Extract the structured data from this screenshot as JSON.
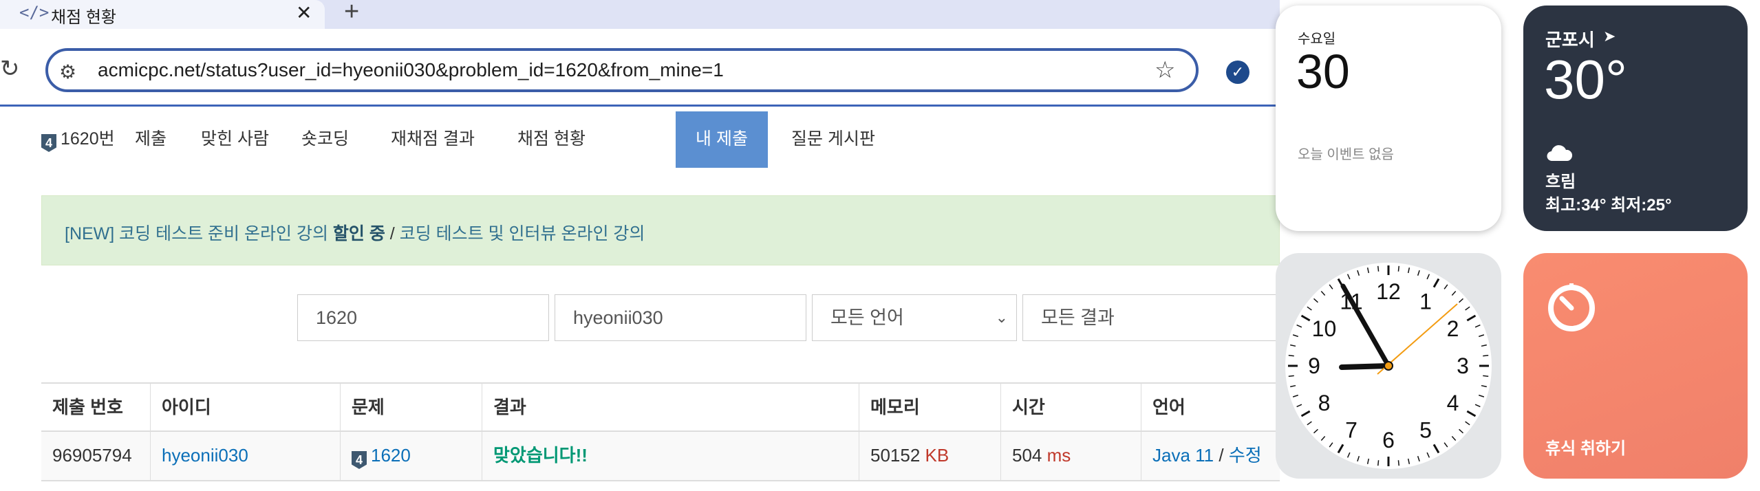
{
  "browser": {
    "tab_title": "채점 현황",
    "tab_icon": "</>",
    "close_glyph": "✕",
    "new_tab_glyph": "+",
    "url": "acmicpc.net/status?user_id=hyeonii030&problem_id=1620&from_mine=1"
  },
  "nav": {
    "tier": "4",
    "items": [
      "1620번",
      "제출",
      "맞힌 사람",
      "숏코딩",
      "재채점 결과",
      "채점 현황",
      "내 제출",
      "질문 게시판"
    ],
    "active": "내 제출"
  },
  "banner": {
    "prefix": "[NEW] 코딩 테스트 준비 온라인 강의 ",
    "highlight": "할인 중",
    "separator": " / ",
    "link2": "코딩 테스트 및 인터뷰 온라인 강의"
  },
  "filters": {
    "problem": "1620",
    "user": "hyeonii030",
    "language": "모든 언어",
    "result": "모든 결과"
  },
  "table": {
    "headers": [
      "제출 번호",
      "아이디",
      "문제",
      "결과",
      "메모리",
      "시간",
      "언어"
    ],
    "row": {
      "id": "96905794",
      "user": "hyeonii030",
      "problem_tier": "4",
      "problem": "1620",
      "result": "맞았습니다!!",
      "memory": "50152",
      "memory_unit": "KB",
      "time": "504",
      "time_unit": "ms",
      "language": "Java 11",
      "lang_sep": " / ",
      "edit": "수정"
    }
  },
  "widgets": {
    "calendar": {
      "weekday": "수요일",
      "day": "30",
      "events": "오늘 이벤트 없음"
    },
    "weather": {
      "city": "군포시",
      "temp": "30°",
      "condition": "흐림",
      "range": "최고:34° 최저:25°",
      "icon": "cloud-icon"
    },
    "clock": {
      "numerals": [
        "12",
        "1",
        "2",
        "3",
        "4",
        "5",
        "6",
        "7",
        "8",
        "9",
        "10",
        "11"
      ]
    },
    "timer": {
      "label": "휴식 취하기",
      "icon": "timer-icon"
    }
  },
  "colors": {
    "accent": "#5b8fd1",
    "link": "#0b6fb8",
    "accepted": "#009874",
    "unit": "#c0392b",
    "banner_bg": "#dff0d8"
  }
}
